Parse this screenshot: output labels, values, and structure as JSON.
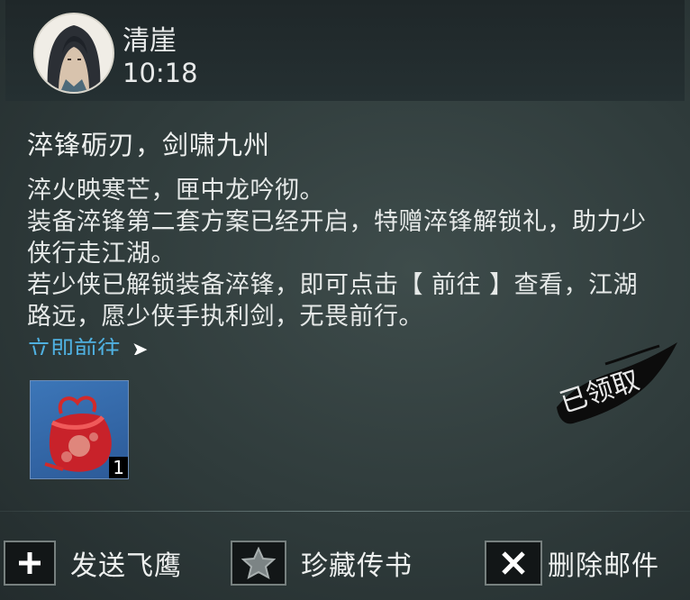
{
  "mail": {
    "sender": "清崖",
    "time": "10:18",
    "subject": "淬锋砺刃，剑啸九州",
    "body": [
      "淬火映寒芒，匣中龙吟彻。",
      "装备淬锋第二套方案已经开启，特赠淬锋解锁礼，助力少侠行走江湖。",
      "若少侠已解锁装备淬锋，即可点击【 前往 】查看，江湖路远，愿少侠手执利剑，无畏前行。"
    ],
    "link_label": "立即前往",
    "attachment": {
      "count": "1",
      "icon": "red-gift-pouch-icon"
    },
    "stamp_text": "已领取"
  },
  "actions": {
    "send": {
      "label": "发送飞鹰",
      "icon": "plus-icon"
    },
    "favorite": {
      "label": "珍藏传书",
      "icon": "star-icon"
    },
    "delete": {
      "label": "删除邮件",
      "icon": "close-icon"
    }
  },
  "colors": {
    "link": "#4fb0e0",
    "text": "#e6e9e8",
    "stamp": "#0c0c0c"
  }
}
